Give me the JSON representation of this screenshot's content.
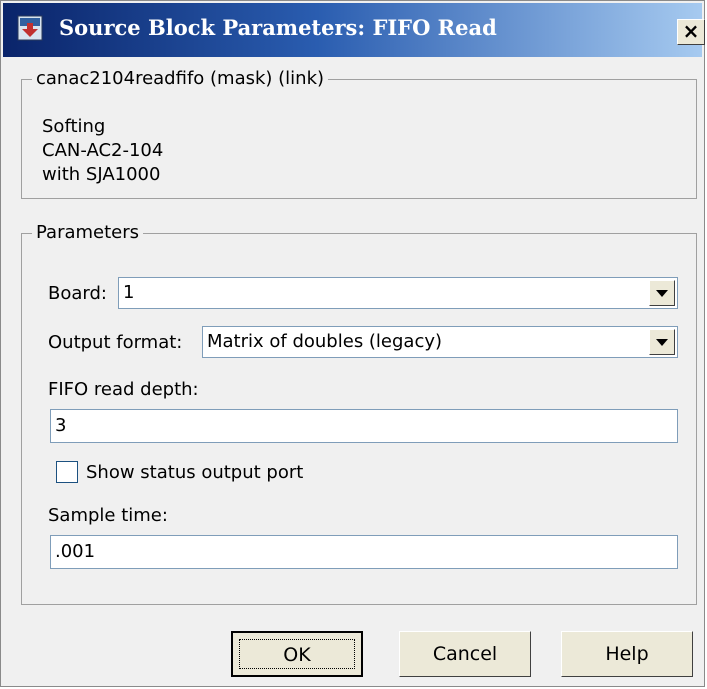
{
  "window": {
    "title": "Source Block Parameters: FIFO Read",
    "close_glyph": "×",
    "icon": "simulink-block-icon"
  },
  "mask_group": {
    "title": "canac2104readfifo (mask) (link)",
    "description_lines": [
      "Softing",
      "CAN-AC2-104",
      "with SJA1000"
    ]
  },
  "params_group": {
    "title": "Parameters",
    "board": {
      "label": "Board:",
      "value": "1"
    },
    "output_format": {
      "label": "Output format:",
      "value": "Matrix of doubles (legacy)"
    },
    "fifo_depth": {
      "label": "FIFO read depth:",
      "value": "3"
    },
    "show_status": {
      "label": "Show status output port",
      "checked": false
    },
    "sample_time": {
      "label": "Sample time:",
      "value": ".001"
    }
  },
  "buttons": {
    "ok": "OK",
    "cancel": "Cancel",
    "help": "Help"
  },
  "colors": {
    "title_gradient_start": "#0a246a",
    "title_gradient_end": "#a6caf0",
    "dialog_bg": "#f0f0f0"
  }
}
